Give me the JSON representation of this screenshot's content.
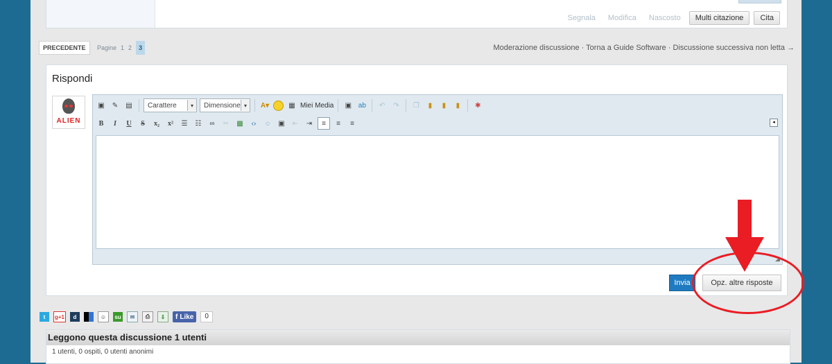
{
  "post": {
    "links": [
      "Segnala",
      "Modifica",
      "Nascosto"
    ],
    "multi_quote": "Multi citazione",
    "quote": "Cita"
  },
  "pagination": {
    "prev": "PRECEDENTE",
    "label": "Pagine",
    "pages": [
      "1",
      "2",
      "3"
    ],
    "current": "3",
    "thread_links": "Moderazione discussione · Torna a Guide Software · Discussione successiva non letta →"
  },
  "reply": {
    "title": "Rispondi",
    "avatar_text": "ALIEN",
    "font_select": "Carattere",
    "size_select": "Dimensione",
    "media_label": "Miei Media",
    "message": "",
    "submit": "Invia",
    "more_options": "Opz. altre risposte"
  },
  "social": {
    "like": "Like",
    "like_count": "0",
    "icons": [
      "twitter-icon",
      "google-plus-icon",
      "digg-icon",
      "delicious-icon",
      "reddit-icon",
      "stumbleupon-icon",
      "email-icon",
      "print-icon",
      "download-icon"
    ]
  },
  "readers": {
    "title": "Leggono questa discussione 1 utenti",
    "detail": "1 utenti, 0 ospiti, 0 utenti anonimi"
  },
  "colors": {
    "background": "#1d6b92",
    "accent": "#1f7bc1",
    "annotation": "#ea1c24"
  }
}
